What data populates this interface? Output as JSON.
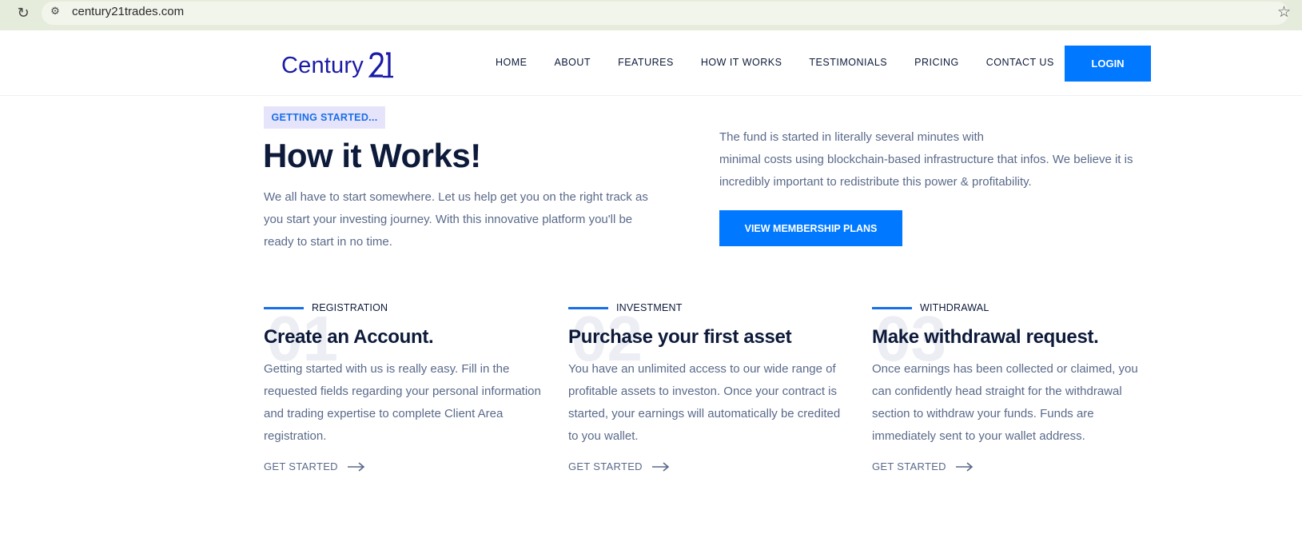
{
  "browser": {
    "url": "century21trades.com",
    "reload_icon": "reload-icon",
    "site_info_icon": "site-info-icon",
    "bookmark_icon": "star-icon"
  },
  "header": {
    "logo_text": "Century",
    "logo_mark": "21",
    "nav": [
      "HOME",
      "ABOUT",
      "FEATURES",
      "HOW IT WORKS",
      "TESTIMONIALS",
      "PRICING",
      "CONTACT US"
    ],
    "login_label": "LOGIN"
  },
  "hero": {
    "tag": "GETTING STARTED...",
    "title": "How it Works!",
    "left_text": "We all have to start somewhere. Let us help get you on the right track as you start your investing journey. With this innovative platform you'll be ready to start in no time.",
    "right_text_line1": "The fund is started in literally several minutes with",
    "right_text_line2": "minimal costs using blockchain-based infrastructure that infos. We believe it is incredibly important to redistribute this power & profitability.",
    "membership_button": "VIEW MEMBERSHIP PLANS"
  },
  "steps": [
    {
      "number": "01",
      "label": "REGISTRATION",
      "title": "Create an Account.",
      "description": "Getting started with us is really easy. Fill in the requested fields regarding your personal information and trading expertise to complete Client Area registration.",
      "link": "GET STARTED"
    },
    {
      "number": "02",
      "label": "INVESTMENT",
      "title": "Purchase your first asset",
      "description": "You have an unlimited access to our wide range of profitable assets to investon. Once your contract is started, your earnings will automatically be credited to you wallet.",
      "link": "GET STARTED"
    },
    {
      "number": "03",
      "label": "WITHDRAWAL",
      "title": "Make withdrawal request.",
      "description": "Once earnings has been collected or claimed, you can confidently head straight for the withdrawal section to withdraw your funds. Funds are immediately sent to your wallet address.",
      "link": "GET STARTED"
    }
  ],
  "colors": {
    "accent": "#0078ff",
    "heading": "#0d1a3a",
    "body_text": "#5a6a8a",
    "logo": "#1a1aa6",
    "tag_bg": "#e6e4fb"
  }
}
